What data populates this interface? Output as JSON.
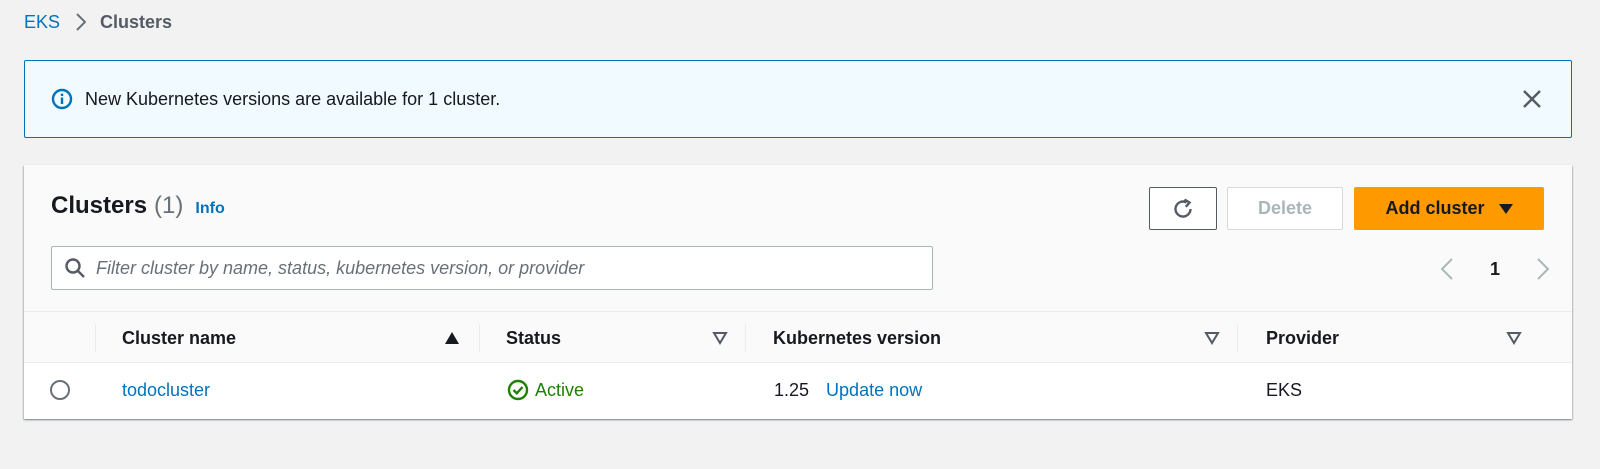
{
  "breadcrumb": {
    "root": "EKS",
    "current": "Clusters"
  },
  "flash": {
    "message": "New Kubernetes versions are available for 1 cluster.",
    "type": "info"
  },
  "panel": {
    "title": "Clusters",
    "count": "(1)",
    "info_link": "Info",
    "refresh_icon": "refresh-icon",
    "delete_label": "Delete",
    "add_label": "Add cluster"
  },
  "search": {
    "placeholder": "Filter cluster by name, status, kubernetes version, or provider",
    "value": ""
  },
  "pagination": {
    "current_page": "1"
  },
  "table": {
    "columns": [
      {
        "label": "Cluster name",
        "sort": "ascending"
      },
      {
        "label": "Status",
        "sort": "none"
      },
      {
        "label": "Kubernetes version",
        "sort": "none"
      },
      {
        "label": "Provider",
        "sort": "none"
      }
    ],
    "rows": [
      {
        "name": "todocluster",
        "status": "Active",
        "version": "1.25",
        "version_action": "Update now",
        "provider": "EKS"
      }
    ]
  },
  "colors": {
    "link": "#0073bb",
    "primary_button": "#ff9900",
    "flash_background": "#f1faff",
    "success": "#1d8102"
  }
}
